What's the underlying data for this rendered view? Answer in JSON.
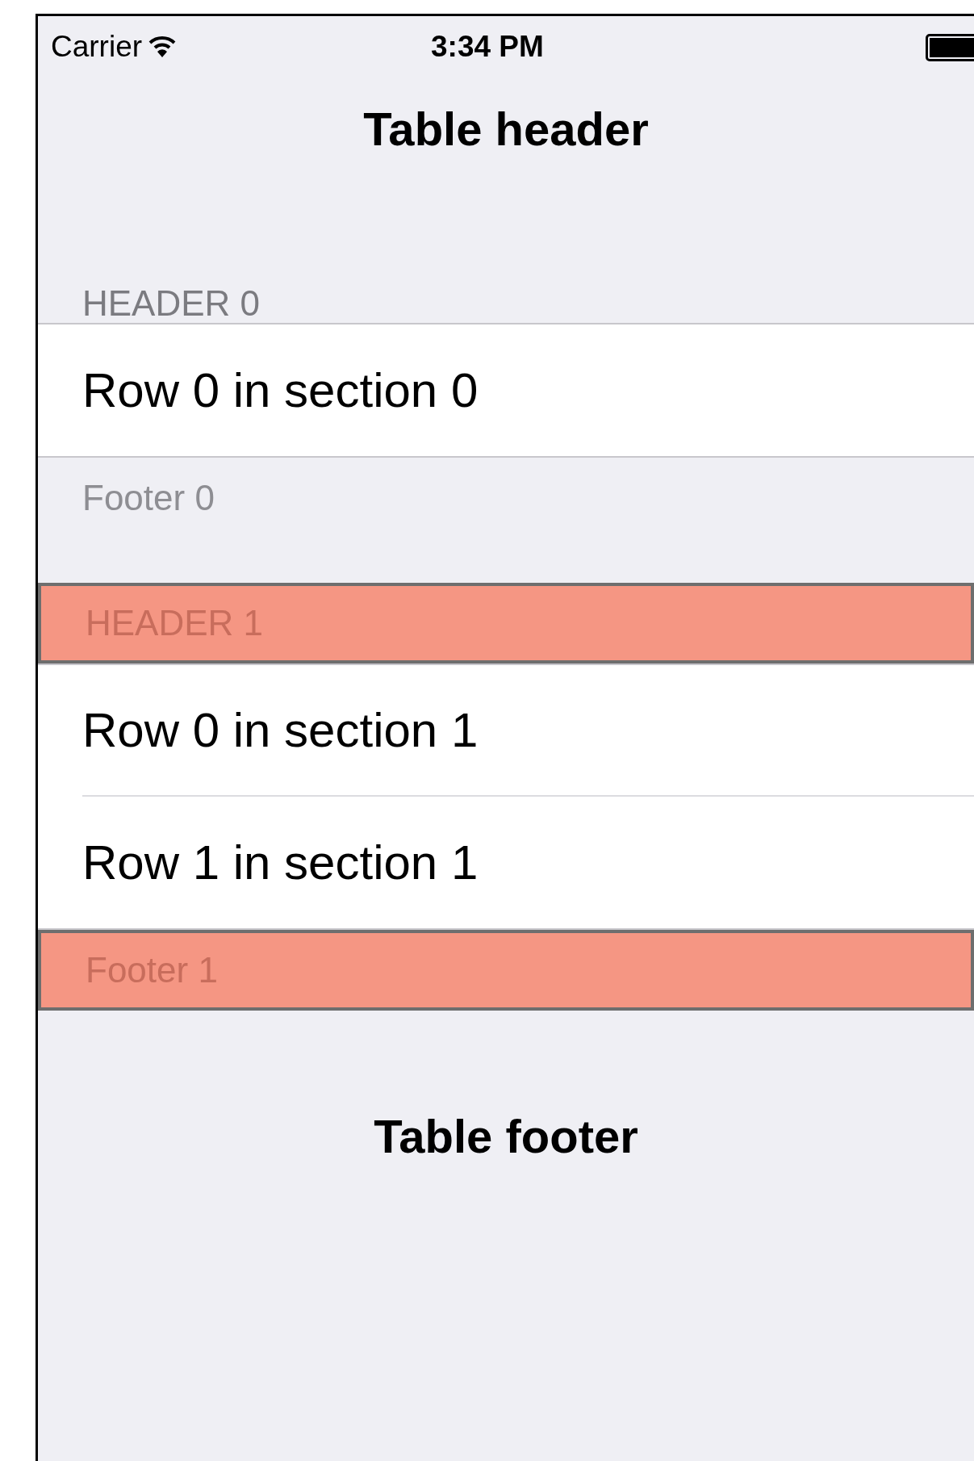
{
  "status_bar": {
    "carrier": "Carrier",
    "time": "3:34 PM"
  },
  "table_header": "Table header",
  "sections": [
    {
      "header": "HEADER 0",
      "highlighted": false,
      "rows": [
        "Row 0 in section 0"
      ],
      "footer": "Footer 0"
    },
    {
      "header": "HEADER 1",
      "highlighted": true,
      "rows": [
        "Row 0 in section 1",
        "Row 1 in section 1"
      ],
      "footer": "Footer 1"
    }
  ],
  "table_footer": "Table footer"
}
